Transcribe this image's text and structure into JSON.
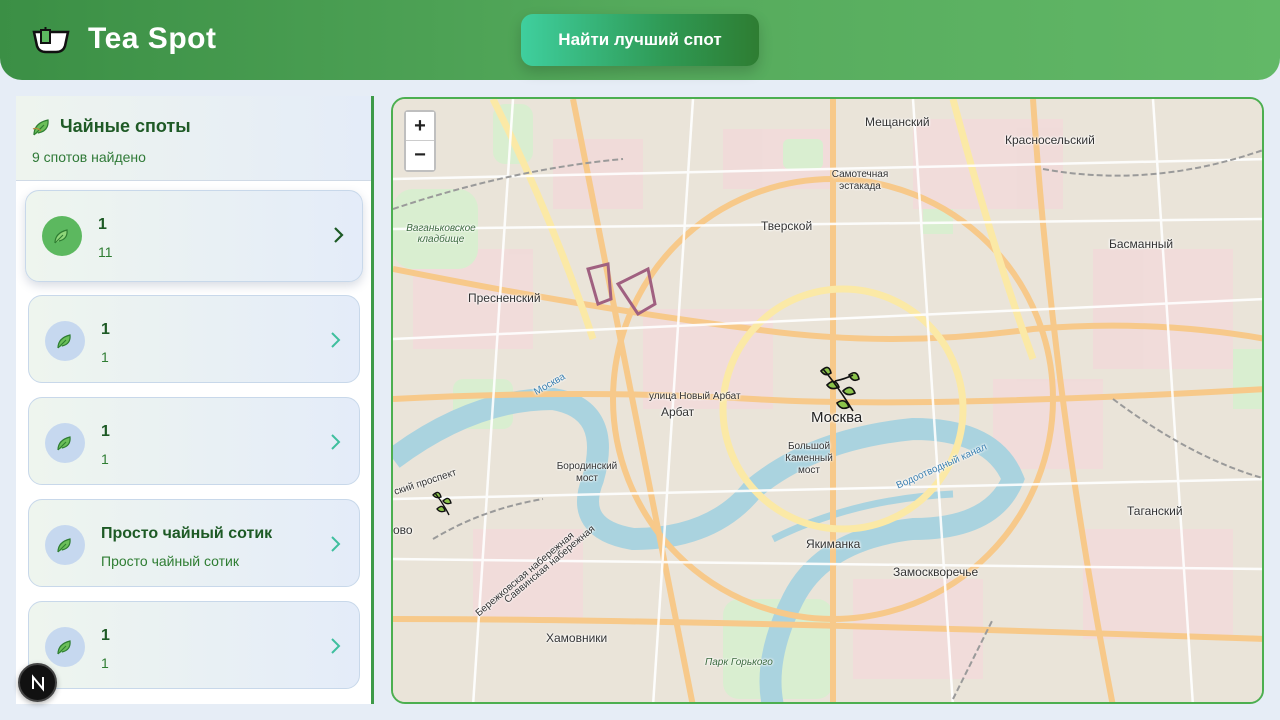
{
  "header": {
    "brand": "Tea Spot",
    "find_button": "Найти лучший спот"
  },
  "sidebar": {
    "title": "Чайные споты",
    "count": "9 спотов найдено",
    "spots": [
      {
        "name": "1",
        "desc": "11"
      },
      {
        "name": "1",
        "desc": "1"
      },
      {
        "name": "1",
        "desc": "1"
      },
      {
        "name": "Просто чайный сотик",
        "desc": "Просто чайный сотик"
      },
      {
        "name": "1",
        "desc": "1"
      }
    ]
  },
  "map": {
    "zoom_in": "+",
    "zoom_out": "−",
    "labels": {
      "meshchansky": "Мещанский",
      "krasnoselsky": "Красносельский",
      "samotechnaya": "Самотечная эстакада",
      "tverskoy": "Тверской",
      "vagankovskoe": "Ваганьковское кладбище",
      "basmanny": "Басманный",
      "presnensky": "Пресненский",
      "novy_arbat": "улица Новый Арбат",
      "arbat": "Арбат",
      "moscow": "Москва",
      "bolshoy_kamenny": "Большой Каменный мост",
      "borodinsky": "Бородинский мост",
      "taganskiy": "Таганский",
      "yakimanka": "Якиманка",
      "zamoskvorechye": "Замоскворечье",
      "khamovniki": "Хамовники",
      "park_gorkogo": "Парк Горького",
      "vodootvodny": "Водоотводный канал",
      "berezhkovskaya": "Бережковская набережная",
      "savvinskaya": "Саввинская набережная",
      "kutuzovsky": "ский проспект",
      "ovo": "ово",
      "moskva_river": "Москва"
    }
  },
  "colors": {
    "header_green": "#4caf50",
    "accent_teal": "#3fcf9e",
    "text_dark_green": "#1d5a25"
  },
  "icons": {
    "logo": "tea-bowl-icon",
    "spot": "tea-leaf-icon",
    "chevron": "chevron-right-icon",
    "marker": "tea-sprig-marker-icon",
    "next": "next-logo-icon"
  }
}
